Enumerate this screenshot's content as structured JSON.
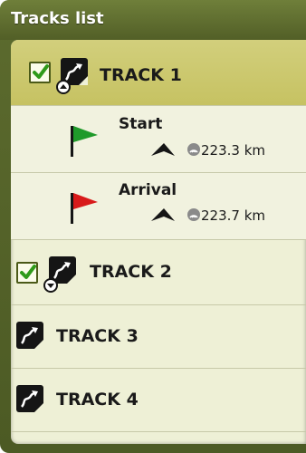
{
  "header": {
    "title": "Tracks list"
  },
  "tracks": [
    {
      "label": "TRACK 1",
      "checked": true,
      "expanded": true,
      "selected": true,
      "waypoints": [
        {
          "title": "Start",
          "distance": "223.3 km",
          "flag_color": "#1f9a2a"
        },
        {
          "title": "Arrival",
          "distance": "223.7 km",
          "flag_color": "#d81a1a"
        }
      ]
    },
    {
      "label": "TRACK 2",
      "checked": true,
      "expanded": false,
      "selected": false
    },
    {
      "label": "TRACK 3",
      "checked": false,
      "expanded": false,
      "selected": false
    },
    {
      "label": "TRACK 4",
      "checked": false,
      "expanded": false,
      "selected": false
    }
  ],
  "colors": {
    "panel": "#56652a",
    "list_bg": "#eef0d6",
    "selected_row": "#cdc96f",
    "check_green": "#2f9a1a"
  },
  "icons": {
    "checkbox": "check-icon",
    "track": "track-route-icon",
    "expand": "expand-arrow-icon",
    "direction": "direction-arrow-icon",
    "gps": "gps-signal-icon",
    "flag": "flag-icon"
  }
}
